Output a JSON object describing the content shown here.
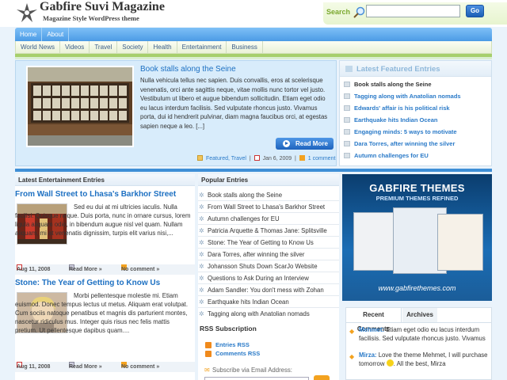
{
  "header": {
    "site_title": "Gabfire Suvi Magazine",
    "tagline": "Magazine Style WordPress theme",
    "search_label": "Search",
    "search_value": "",
    "search_button": "Go"
  },
  "nav_main": [
    "Home",
    "About"
  ],
  "nav_sub": [
    "World News",
    "Videos",
    "Travel",
    "Society",
    "Health",
    "Entertainment",
    "Business"
  ],
  "featured": {
    "title": "Book stalls along the Seine",
    "text": "Nulla vehicula tellus nec sapien. Duis convallis, eros at scelerisque venenatis, orci ante sagittis neque, vitae mollis nunc tortor vel justo. Vestibulum ut libero et augue bibendum sollicitudin. Etiam eget odio eu lacus interdum facilisis. Sed vulputate rhoncus justo. Vivamus porta, dui id hendrerit pulvinar, diam magna faucibus orci, at egestas sapien neque a leo. [...]",
    "read_more": "Read More",
    "categories": "Featured, Travel",
    "date": "Jan 6, 2009",
    "comments": "1 comment"
  },
  "latest_featured": {
    "title": "Latest Featured Entries",
    "items": [
      "Book stalls along the Seine",
      "Tagging along with Anatolian nomads",
      "Edwards' affair is his political risk",
      "Earthquake hits Indian Ocean",
      "Engaging minds: 5 ways to motivate",
      "Dara Torres, after winning the silver",
      "Autumn challenges for EU"
    ]
  },
  "entertainment": {
    "heading": "Latest Entertainment Entries",
    "entries": [
      {
        "title": "From Wall Street to Lhasa's Barkhor Street",
        "text": "Sed eu dui at mi ultricies iaculis. Nulla facilisi. Quisque neque. Duis porta, nunc in ornare cursus, lorem ligula aliquam odio, in bibendum augue nisl vel quam. Nullam aliquam, mi at venenatis dignissim, turpis elit varius nisi,...",
        "date": "Aug 11, 2008",
        "read_more": "Read More »",
        "comments": "No comment »"
      },
      {
        "title": "Stone: The Year of Getting to Know Us",
        "text": "Morbi pellentesque molestie mi. Etiam euismod. Donec tempus lectus ut metus. Aliquam erat volutpat. Cum sociis natoque penatibus et magnis dis parturient montes, nascetur ridiculus mus. Integer quis risus nec felis mattis pretium. Ut pellentesque dapibus quam....",
        "date": "Aug 11, 2008",
        "read_more": "Read More »",
        "comments": "No comment »"
      }
    ]
  },
  "popular": {
    "heading": "Popular Entries",
    "items": [
      "Book stalls along the Seine",
      "From Wall Street to Lhasa's Barkhor Street",
      "Autumn challenges for EU",
      "Patricia Arquette & Thomas Jane: Splitsville",
      "Stone: The Year of Getting to Know Us",
      "Dara Torres, after winning the silver",
      "Johansson Shuts Down ScarJo Website",
      "Questions to Ask During an Interview",
      "Adam Sandler: You don't mess with Zohan",
      "Earthquake hits Indian Ocean",
      "Tagging along with Anatolian nomads"
    ]
  },
  "rss": {
    "heading": "RSS Subscription",
    "entries_rss": "Entries RSS",
    "comments_rss": "Comments RSS",
    "subscribe_label": "Subscribe via Email Address:"
  },
  "ad": {
    "title": "GABFIRE THEMES",
    "subtitle": "PREMIUM THEMES REFINED",
    "url": "www.gabfirethemes.com"
  },
  "comments_box": {
    "tab_recent": "Recent Comments",
    "tab_archives": "Archives",
    "items": [
      {
        "author": "Mehmet:",
        "text": " Etiam eget odio eu lacus interdum facilisis. Sed vulputate rhoncus justo. Vivamus"
      },
      {
        "author": "Mirza:",
        "text": " Love the theme Mehmet, I will purchase tomorrow",
        "tail": ". All the best, Mirza"
      }
    ]
  },
  "colors": {
    "accent_blue": "#1d70c2",
    "nav_blue": "#4b9be5",
    "green_stripe": "#a6cf6b",
    "orange": "#f3a21f"
  }
}
